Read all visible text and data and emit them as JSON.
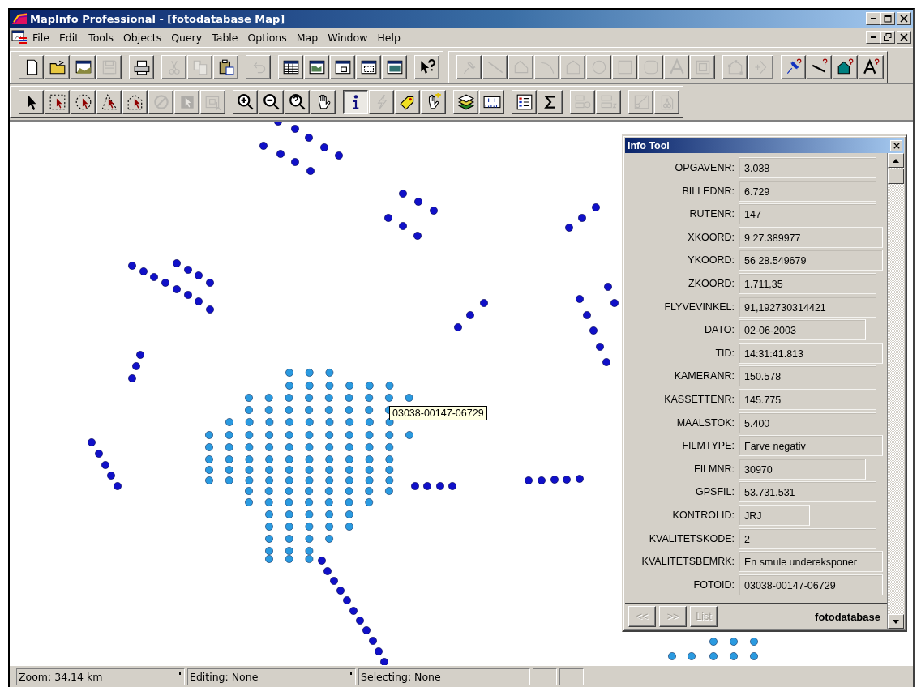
{
  "window": {
    "title": "MapInfo Professional - [fotodatabase Map]"
  },
  "menu": [
    "File",
    "Edit",
    "Tools",
    "Objects",
    "Query",
    "Table",
    "Options",
    "Map",
    "Window",
    "Help"
  ],
  "toolbar_rows": [
    [
      {
        "groups": [
          [
            {
              "kind": "blank-page",
              "disabled": false
            },
            {
              "kind": "folder",
              "disabled": false
            },
            {
              "kind": "workspace",
              "disabled": false
            },
            {
              "kind": "floppy",
              "disabled": true
            }
          ],
          [
            {
              "kind": "printer",
              "disabled": false
            }
          ],
          [
            {
              "kind": "scissors",
              "disabled": true
            },
            {
              "kind": "copy",
              "disabled": true
            },
            {
              "kind": "clipboard",
              "disabled": false
            }
          ],
          [
            {
              "kind": "undo",
              "disabled": true
            }
          ],
          [
            {
              "kind": "table-window",
              "disabled": false
            },
            {
              "kind": "map-window",
              "disabled": false
            },
            {
              "kind": "graph-window",
              "disabled": false
            },
            {
              "kind": "layout-window",
              "disabled": false
            },
            {
              "kind": "redistrict-window",
              "disabled": false
            }
          ],
          [
            {
              "kind": "pointer-help",
              "disabled": false
            }
          ]
        ]
      },
      {
        "groups": [
          [
            {
              "kind": "pin",
              "disabled": true
            },
            {
              "kind": "line",
              "disabled": true
            },
            {
              "kind": "polyline",
              "disabled": true
            },
            {
              "kind": "arc",
              "disabled": true
            },
            {
              "kind": "polygon",
              "disabled": true
            },
            {
              "kind": "ellipse",
              "disabled": true
            },
            {
              "kind": "rectangle",
              "disabled": true
            },
            {
              "kind": "rounded-rectangle",
              "disabled": true
            },
            {
              "kind": "text-tool",
              "disabled": true
            },
            {
              "kind": "frame",
              "disabled": true
            }
          ],
          [
            {
              "kind": "reshape",
              "disabled": true
            },
            {
              "kind": "add-node",
              "disabled": true
            }
          ],
          [
            {
              "kind": "pin-style",
              "disabled": false
            },
            {
              "kind": "line-style",
              "disabled": false
            },
            {
              "kind": "region-style",
              "disabled": false
            },
            {
              "kind": "text-style",
              "disabled": false
            }
          ]
        ]
      }
    ],
    [
      {
        "groups": [
          [
            {
              "kind": "arrow",
              "disabled": false,
              "selected": false
            },
            {
              "kind": "marquee-select",
              "disabled": false,
              "selected": false
            },
            {
              "kind": "radius-select",
              "disabled": false,
              "selected": false
            },
            {
              "kind": "polygon-select",
              "disabled": false,
              "selected": false
            },
            {
              "kind": "boundary-select",
              "disabled": false,
              "selected": false
            },
            {
              "kind": "unselect",
              "disabled": true,
              "selected": false
            },
            {
              "kind": "graph-select",
              "disabled": true,
              "selected": false
            },
            {
              "kind": "invert-select",
              "disabled": true,
              "selected": false
            }
          ],
          [
            {
              "kind": "zoom-in",
              "disabled": false,
              "selected": false
            },
            {
              "kind": "zoom-out",
              "disabled": false,
              "selected": false
            },
            {
              "kind": "change-view",
              "disabled": false,
              "selected": false
            },
            {
              "kind": "hand",
              "disabled": false,
              "selected": false
            }
          ],
          [
            {
              "kind": "info",
              "disabled": false,
              "selected": true
            },
            {
              "kind": "lightning",
              "disabled": true,
              "selected": false
            },
            {
              "kind": "label-tag",
              "disabled": false,
              "selected": false
            },
            {
              "kind": "drag-hand",
              "disabled": false,
              "selected": false
            }
          ],
          [
            {
              "kind": "layers",
              "disabled": false,
              "selected": false
            },
            {
              "kind": "ruler",
              "disabled": false,
              "selected": false
            }
          ],
          [
            {
              "kind": "legend",
              "disabled": false,
              "selected": false
            },
            {
              "kind": "sigma",
              "disabled": false,
              "selected": false
            }
          ],
          [
            {
              "kind": "add-theme",
              "disabled": true,
              "selected": false
            },
            {
              "kind": "thematic",
              "disabled": true,
              "selected": false
            }
          ],
          [
            {
              "kind": "clip",
              "disabled": true,
              "selected": false
            },
            {
              "kind": "cutter",
              "disabled": true,
              "selected": false
            }
          ]
        ]
      }
    ]
  ],
  "map": {
    "tooltip": "03038-00147-06729"
  },
  "info_tool": {
    "title": "Info Tool",
    "fields": [
      {
        "label": "OPGAVENR:",
        "value": "3.038"
      },
      {
        "label": "BILLEDNR:",
        "value": "6.729"
      },
      {
        "label": "RUTENR:",
        "value": "147"
      },
      {
        "label": "XKOORD:",
        "value": "9 27.389977"
      },
      {
        "label": "YKOORD:",
        "value": "56 28.549679"
      },
      {
        "label": "ZKOORD:",
        "value": "1.711,35"
      },
      {
        "label": "FLYVEVINKEL:",
        "value": "91,192730314421"
      },
      {
        "label": "DATO:",
        "value": "02-06-2003"
      },
      {
        "label": "TID:",
        "value": "14:31:41.813"
      },
      {
        "label": "KAMERANR:",
        "value": "150.578"
      },
      {
        "label": "KASSETTENR:",
        "value": "145.775"
      },
      {
        "label": "MAALSTOK:",
        "value": "5.400"
      },
      {
        "label": "FILMTYPE:",
        "value": "Farve negativ"
      },
      {
        "label": "FILMNR:",
        "value": "30970"
      },
      {
        "label": "GPSFIL:",
        "value": "53.731.531"
      },
      {
        "label": "KONTROLID:",
        "value": "JRJ"
      },
      {
        "label": "KVALITETSKODE:",
        "value": "2"
      },
      {
        "label": "KVALITETSBEMRK:",
        "value": "En smule undereksponer"
      },
      {
        "label": "FOTOID:",
        "value": "03038-00147-06729"
      }
    ],
    "buttons": [
      {
        "label": "<<",
        "disabled": true
      },
      {
        "label": ">>",
        "disabled": true
      },
      {
        "label": "List",
        "disabled": true
      }
    ],
    "table": "fotodatabase"
  },
  "status_bar": [
    {
      "kind": "text",
      "text": "Zoom: 34,14 km",
      "menu_marker": true
    },
    {
      "kind": "text",
      "text": "Editing: None",
      "menu_marker": true
    },
    {
      "kind": "text",
      "text": "Selecting: None",
      "menu_marker": false
    },
    {
      "kind": "empty"
    },
    {
      "kind": "empty"
    }
  ]
}
